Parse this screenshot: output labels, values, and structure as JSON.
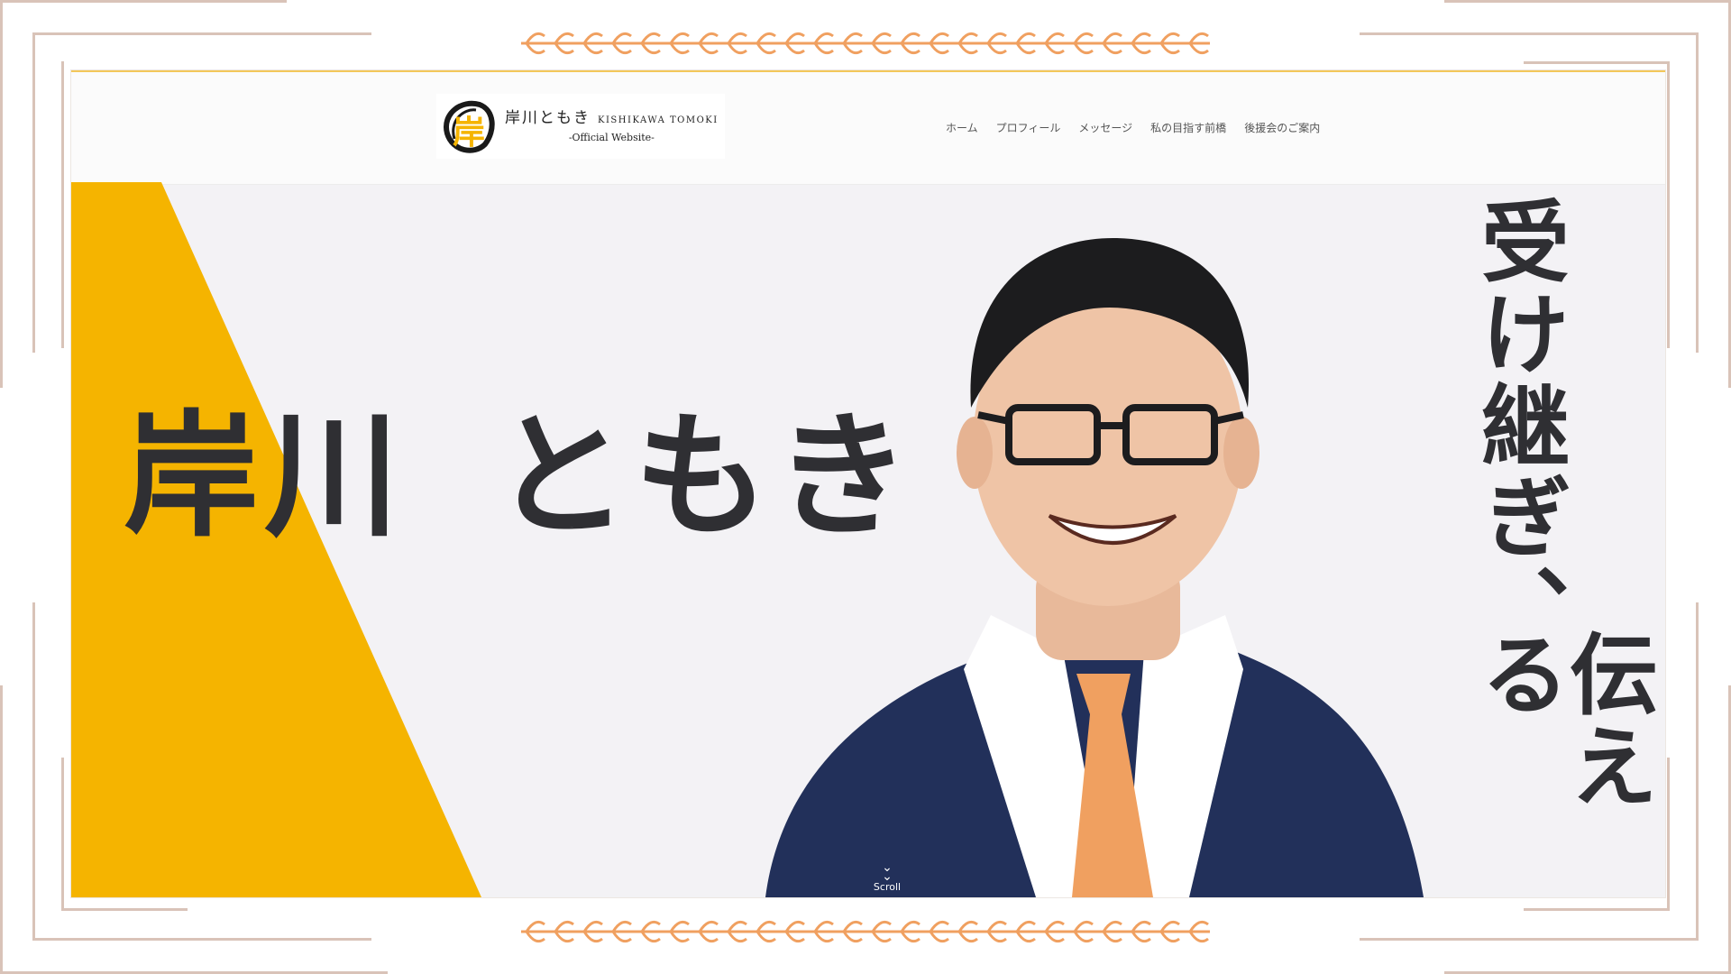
{
  "header": {
    "logo": {
      "mark_char": "岸",
      "name": "岸川ともき",
      "name_roman": "KISHIKAWA TOMOKI",
      "subtitle": "-Official Website-"
    },
    "nav": [
      {
        "label": "ホーム"
      },
      {
        "label": "プロフィール"
      },
      {
        "label": "メッセージ"
      },
      {
        "label": "私の目指す前橋"
      },
      {
        "label": "後援会のご案内"
      }
    ]
  },
  "hero": {
    "name": "岸川 ともき",
    "tagline_1": "受け継ぎ、",
    "tagline_2": "伝える",
    "scroll_label": "Scroll"
  },
  "colors": {
    "accent_yellow": "#f5b400",
    "frame": "#d9c3b8",
    "garland": "#f0a060",
    "text_dark": "#2f2f33",
    "suit": "#22305a",
    "tie": "#f0a060"
  }
}
